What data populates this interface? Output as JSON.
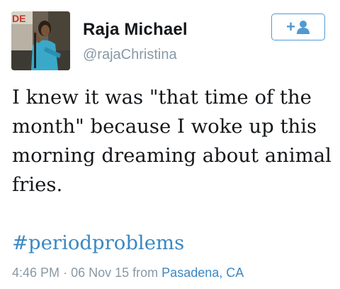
{
  "tweet": {
    "author": {
      "name": "Raja Michael",
      "handle": "@rajaChristina"
    },
    "follow_button": {
      "label": "+",
      "icon": "add-user-icon"
    },
    "text": "I knew it was \"that time of the month\" because I woke up this morning dreaming about animal fries.",
    "hashtag": "#periodproblems",
    "meta": {
      "time": "4:46 PM",
      "separator": "·",
      "date": "06 Nov 15",
      "from_label": "from",
      "location": "Pasadena, CA"
    }
  },
  "colors": {
    "accent": "#3b88c3",
    "muted": "#8899a6",
    "text": "#14171a",
    "button_border": "#4f9ad3"
  }
}
